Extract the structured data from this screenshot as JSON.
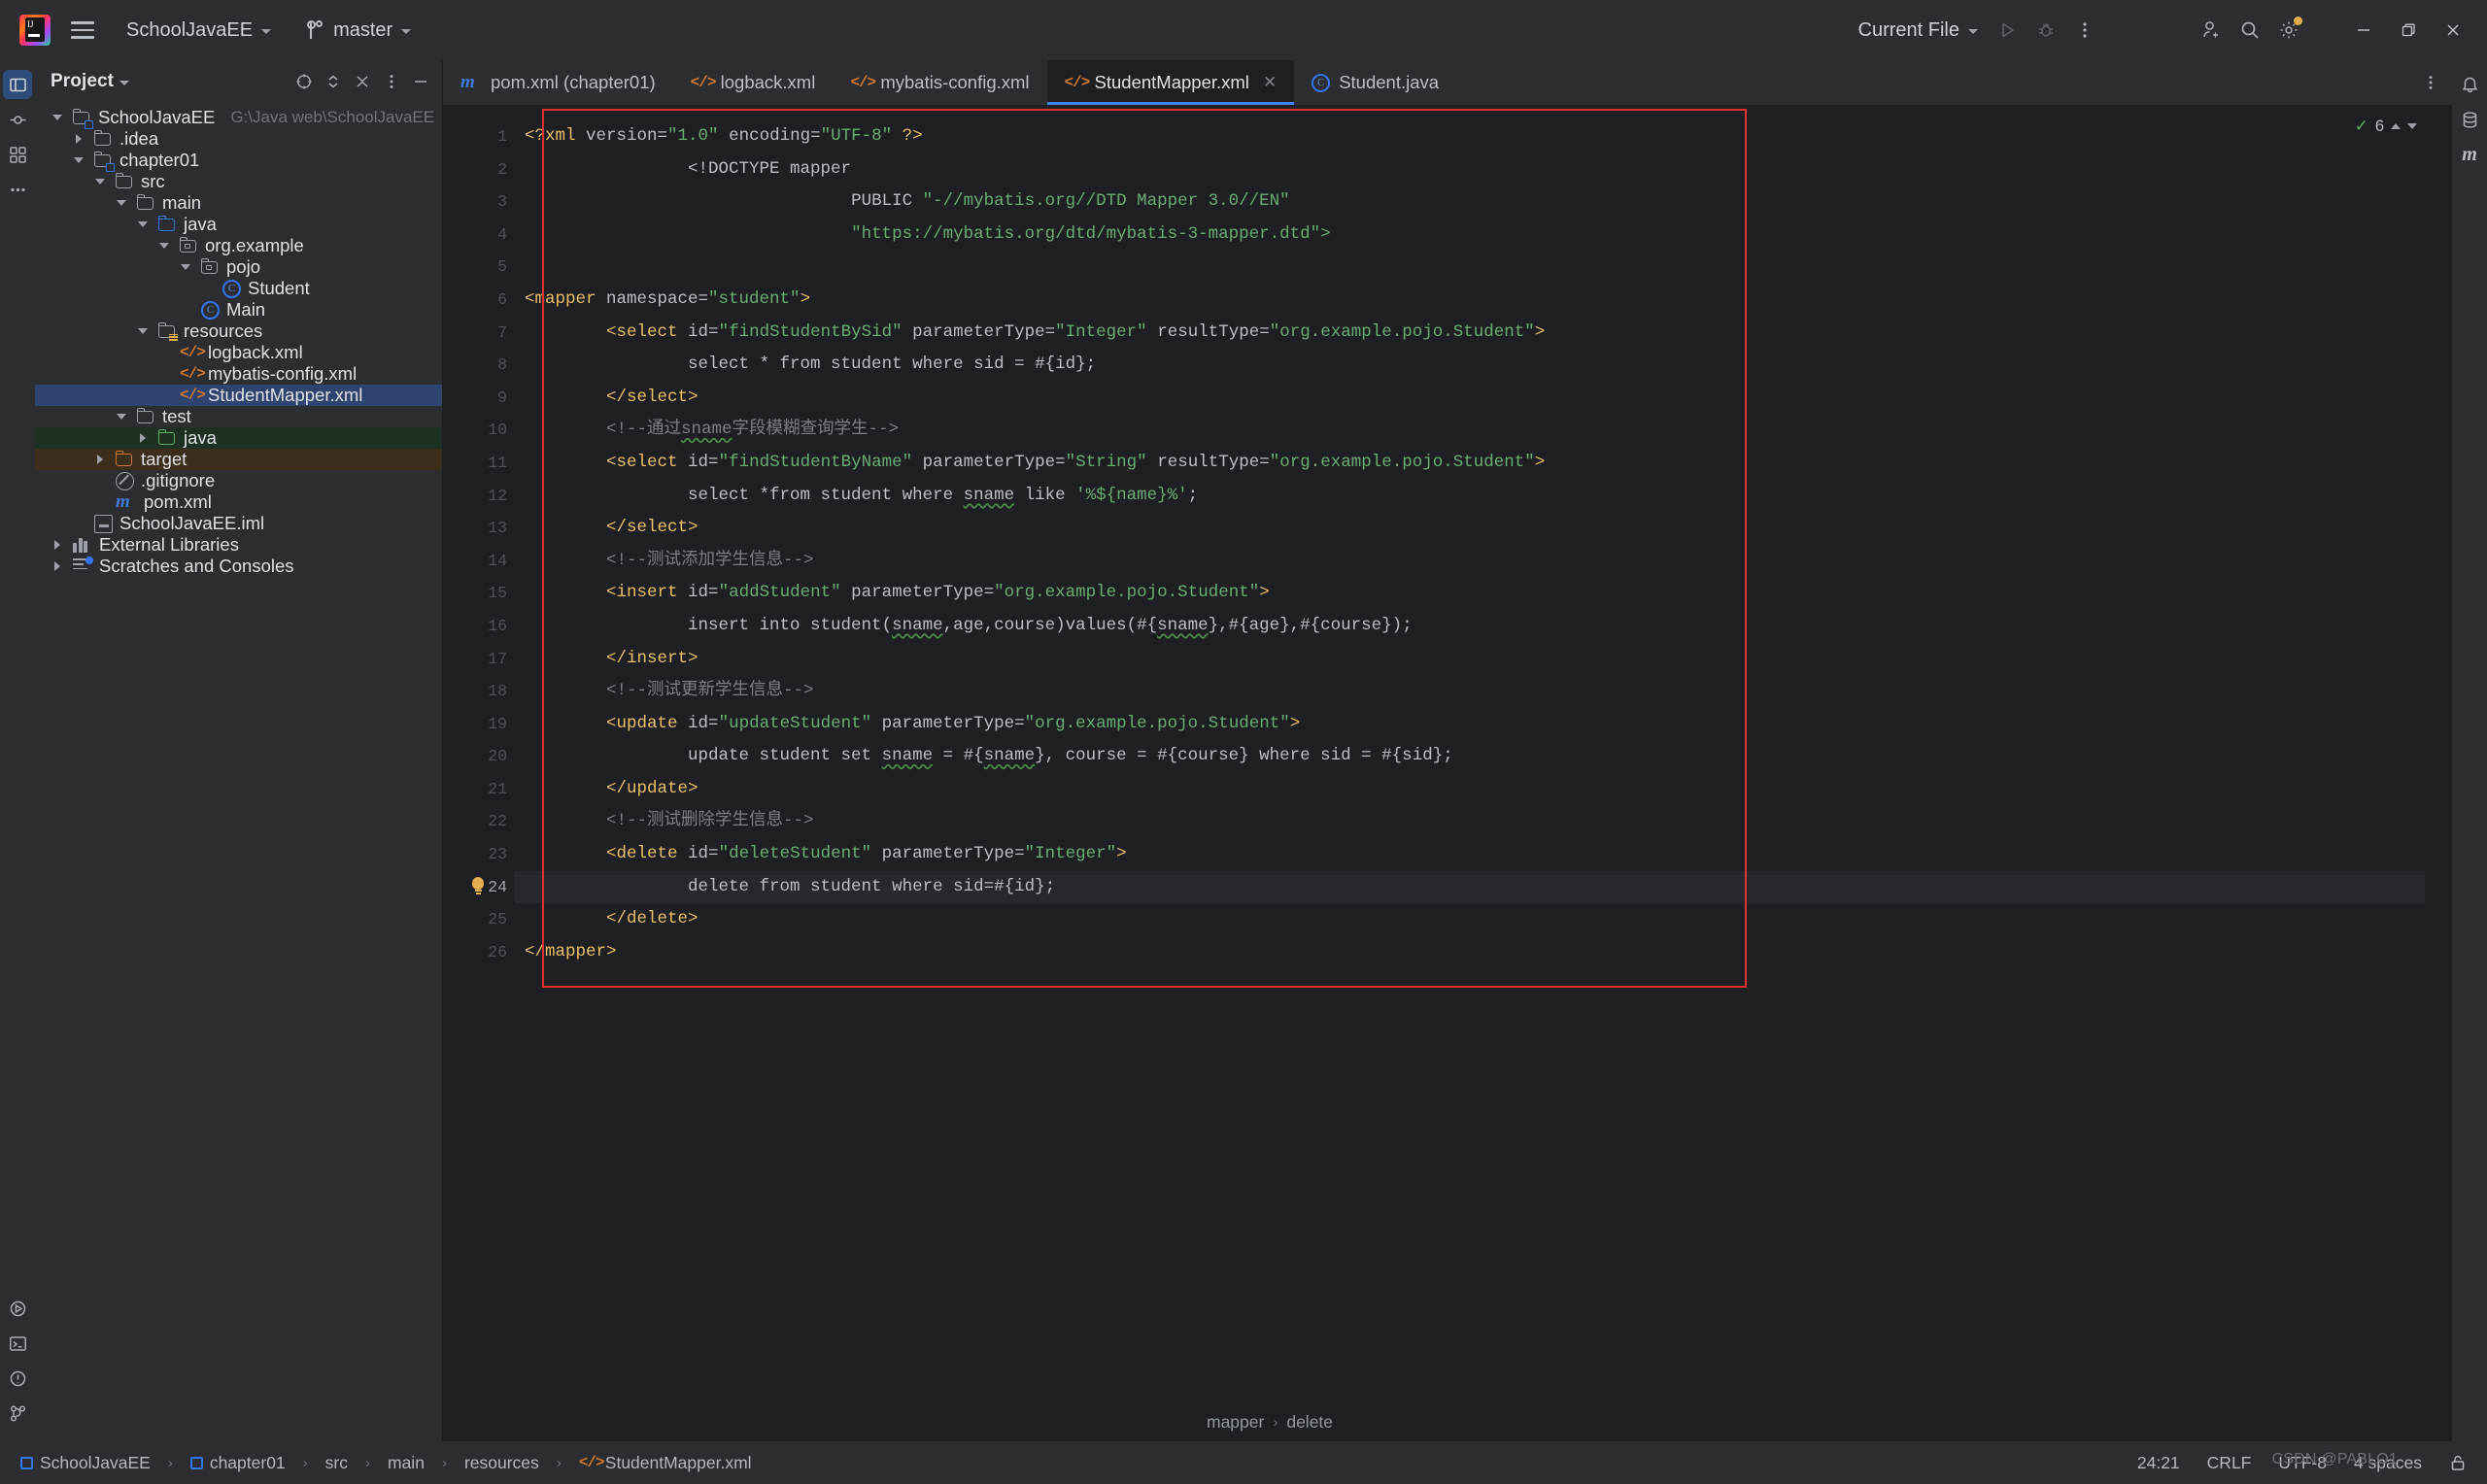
{
  "titlebar": {
    "project_name": "SchoolJavaEE",
    "branch": "master",
    "run_config": "Current File",
    "logo_text": "IJ"
  },
  "project_panel": {
    "title": "Project",
    "tree": [
      {
        "indent": 0,
        "arrow": "down",
        "icon": "module-folder",
        "label": "SchoolJavaEE",
        "path": "G:\\Java web\\SchoolJavaEE",
        "state": "normal"
      },
      {
        "indent": 1,
        "arrow": "right",
        "icon": "folder",
        "label": "",
        "state": "normal",
        "label_text": ".idea"
      },
      {
        "indent": 1,
        "arrow": "down",
        "icon": "module-folder",
        "label": "chapter01",
        "state": "normal"
      },
      {
        "indent": 2,
        "arrow": "down",
        "icon": "folder",
        "label": "src",
        "state": "normal"
      },
      {
        "indent": 3,
        "arrow": "down",
        "icon": "folder",
        "label": "main",
        "state": "normal"
      },
      {
        "indent": 4,
        "arrow": "down",
        "icon": "folder-blue",
        "label": "java",
        "state": "normal"
      },
      {
        "indent": 5,
        "arrow": "down",
        "icon": "package",
        "label": "org.example",
        "state": "normal"
      },
      {
        "indent": 6,
        "arrow": "down",
        "icon": "package",
        "label": "pojo",
        "state": "normal"
      },
      {
        "indent": 7,
        "arrow": "none",
        "icon": "class",
        "label": "Student",
        "state": "normal"
      },
      {
        "indent": 6,
        "arrow": "none",
        "icon": "class",
        "label": "Main",
        "state": "normal"
      },
      {
        "indent": 4,
        "arrow": "down",
        "icon": "folder-resources",
        "label": "resources",
        "state": "normal"
      },
      {
        "indent": 5,
        "arrow": "none",
        "icon": "xml",
        "label": "logback.xml",
        "state": "normal"
      },
      {
        "indent": 5,
        "arrow": "none",
        "icon": "xml",
        "label": "mybatis-config.xml",
        "state": "normal"
      },
      {
        "indent": 5,
        "arrow": "none",
        "icon": "xml",
        "label": "StudentMapper.xml",
        "state": "selected"
      },
      {
        "indent": 3,
        "arrow": "down",
        "icon": "folder",
        "label": "test",
        "state": "normal"
      },
      {
        "indent": 4,
        "arrow": "right",
        "icon": "folder-green",
        "label": "java",
        "state": "test"
      },
      {
        "indent": 2,
        "arrow": "right",
        "icon": "folder-orange",
        "label": "target",
        "state": "target"
      },
      {
        "indent": 2,
        "arrow": "none",
        "icon": "gitignore",
        "label": ".gitignore",
        "state": "normal"
      },
      {
        "indent": 2,
        "arrow": "none",
        "icon": "maven",
        "label": "pom.xml",
        "state": "normal"
      },
      {
        "indent": 1,
        "arrow": "none",
        "icon": "iml",
        "label": "SchoolJavaEE.iml",
        "state": "normal"
      },
      {
        "indent": 0,
        "arrow": "right",
        "icon": "libraries",
        "label": "External Libraries",
        "state": "normal"
      },
      {
        "indent": 0,
        "arrow": "right",
        "icon": "scratches",
        "label": "Scratches and Consoles",
        "state": "normal"
      }
    ]
  },
  "editor": {
    "tabs": [
      {
        "label": "pom.xml (chapter01)",
        "icon": "maven",
        "active": false,
        "closable": false
      },
      {
        "label": "logback.xml",
        "icon": "xml",
        "active": false,
        "closable": false
      },
      {
        "label": "mybatis-config.xml",
        "icon": "xml",
        "active": false,
        "closable": false
      },
      {
        "label": "StudentMapper.xml",
        "icon": "xml",
        "active": true,
        "closable": true
      },
      {
        "label": "Student.java",
        "icon": "class",
        "active": false,
        "closable": false
      }
    ],
    "inspection_count": "6",
    "current_line": 24,
    "total_lines": 26,
    "breadcrumb": [
      "mapper",
      "delete"
    ],
    "lines": [
      {
        "n": 1,
        "segments": [
          {
            "t": "<?xml ",
            "c": "t-tag"
          },
          {
            "t": "version",
            "c": "t-attr"
          },
          {
            "t": "=",
            "c": "t-punct"
          },
          {
            "t": "\"1.0\"",
            "c": "t-str"
          },
          {
            "t": " ",
            "c": "t-text"
          },
          {
            "t": "encoding",
            "c": "t-attr"
          },
          {
            "t": "=",
            "c": "t-punct"
          },
          {
            "t": "\"UTF-8\"",
            "c": "t-str"
          },
          {
            "t": " ?>",
            "c": "t-tag"
          }
        ],
        "indent": 0
      },
      {
        "n": 2,
        "segments": [
          {
            "t": "<!DOCTYPE mapper",
            "c": "t-dt"
          }
        ],
        "indent": 4
      },
      {
        "n": 3,
        "segments": [
          {
            "t": "PUBLIC ",
            "c": "t-attr"
          },
          {
            "t": "\"-//mybatis.org//DTD Mapper 3.0//EN\"",
            "c": "t-str"
          }
        ],
        "indent": 8
      },
      {
        "n": 4,
        "segments": [
          {
            "t": "\"https://mybatis.org/dtd/mybatis-3-mapper.dtd\">",
            "c": "t-str"
          }
        ],
        "indent": 8
      },
      {
        "n": 5,
        "segments": [],
        "indent": 0
      },
      {
        "n": 6,
        "segments": [
          {
            "t": "<mapper ",
            "c": "t-tag"
          },
          {
            "t": "namespace",
            "c": "t-attr"
          },
          {
            "t": "=",
            "c": "t-punct"
          },
          {
            "t": "\"student\"",
            "c": "t-str"
          },
          {
            "t": ">",
            "c": "t-tag"
          }
        ],
        "indent": 0
      },
      {
        "n": 7,
        "segments": [
          {
            "t": "<select ",
            "c": "t-tag"
          },
          {
            "t": "id",
            "c": "t-attr"
          },
          {
            "t": "=",
            "c": "t-punct"
          },
          {
            "t": "\"findStudentBySid\"",
            "c": "t-str"
          },
          {
            "t": " ",
            "c": "t-text"
          },
          {
            "t": "parameterType",
            "c": "t-attr"
          },
          {
            "t": "=",
            "c": "t-punct"
          },
          {
            "t": "\"Integer\"",
            "c": "t-str"
          },
          {
            "t": " ",
            "c": "t-text"
          },
          {
            "t": "resultType",
            "c": "t-attr"
          },
          {
            "t": "=",
            "c": "t-punct"
          },
          {
            "t": "\"org.example.pojo.Student\"",
            "c": "t-str"
          },
          {
            "t": ">",
            "c": "t-tag"
          }
        ],
        "indent": 2
      },
      {
        "n": 8,
        "segments": [
          {
            "t": "select * from student where sid = #{id};",
            "c": "t-text"
          }
        ],
        "indent": 4
      },
      {
        "n": 9,
        "segments": [
          {
            "t": "</select>",
            "c": "t-tag"
          }
        ],
        "indent": 2
      },
      {
        "n": 10,
        "segments": [
          {
            "t": "<!--通过",
            "c": "t-cmt"
          },
          {
            "t": "sname",
            "c": "t-cmt squig"
          },
          {
            "t": "字段模糊查询学生-->",
            "c": "t-cmt"
          }
        ],
        "indent": 2
      },
      {
        "n": 11,
        "segments": [
          {
            "t": "<select ",
            "c": "t-tag"
          },
          {
            "t": "id",
            "c": "t-attr"
          },
          {
            "t": "=",
            "c": "t-punct"
          },
          {
            "t": "\"findStudentByName\"",
            "c": "t-str"
          },
          {
            "t": " ",
            "c": "t-text"
          },
          {
            "t": "parameterType",
            "c": "t-attr"
          },
          {
            "t": "=",
            "c": "t-punct"
          },
          {
            "t": "\"String\"",
            "c": "t-str"
          },
          {
            "t": " ",
            "c": "t-text"
          },
          {
            "t": "resultType",
            "c": "t-attr"
          },
          {
            "t": "=",
            "c": "t-punct"
          },
          {
            "t": "\"org.example.pojo.Student\"",
            "c": "t-str"
          },
          {
            "t": ">",
            "c": "t-tag"
          }
        ],
        "indent": 2
      },
      {
        "n": 12,
        "segments": [
          {
            "t": "select *from student where ",
            "c": "t-text"
          },
          {
            "t": "sname",
            "c": "t-text squig"
          },
          {
            "t": " like ",
            "c": "t-text"
          },
          {
            "t": "'%${name}%'",
            "c": "t-sq"
          },
          {
            "t": ";",
            "c": "t-text"
          }
        ],
        "indent": 4
      },
      {
        "n": 13,
        "segments": [
          {
            "t": "</select>",
            "c": "t-tag"
          }
        ],
        "indent": 2
      },
      {
        "n": 14,
        "segments": [
          {
            "t": "<!--测试添加学生信息-->",
            "c": "t-cmt"
          }
        ],
        "indent": 2
      },
      {
        "n": 15,
        "segments": [
          {
            "t": "<insert ",
            "c": "t-tag"
          },
          {
            "t": "id",
            "c": "t-attr"
          },
          {
            "t": "=",
            "c": "t-punct"
          },
          {
            "t": "\"addStudent\"",
            "c": "t-str"
          },
          {
            "t": " ",
            "c": "t-text"
          },
          {
            "t": "parameterType",
            "c": "t-attr"
          },
          {
            "t": "=",
            "c": "t-punct"
          },
          {
            "t": "\"org.example.pojo.Student\"",
            "c": "t-str"
          },
          {
            "t": ">",
            "c": "t-tag"
          }
        ],
        "indent": 2
      },
      {
        "n": 16,
        "segments": [
          {
            "t": "insert into student(",
            "c": "t-text"
          },
          {
            "t": "sname",
            "c": "t-text squig"
          },
          {
            "t": ",age,course)values(#{",
            "c": "t-text"
          },
          {
            "t": "sname",
            "c": "t-text squig"
          },
          {
            "t": "},#{age},#{course});",
            "c": "t-text"
          }
        ],
        "indent": 4
      },
      {
        "n": 17,
        "segments": [
          {
            "t": "</insert>",
            "c": "t-tag"
          }
        ],
        "indent": 2
      },
      {
        "n": 18,
        "segments": [
          {
            "t": "<!--测试更新学生信息-->",
            "c": "t-cmt"
          }
        ],
        "indent": 2
      },
      {
        "n": 19,
        "segments": [
          {
            "t": "<update ",
            "c": "t-tag"
          },
          {
            "t": "id",
            "c": "t-attr"
          },
          {
            "t": "=",
            "c": "t-punct"
          },
          {
            "t": "\"updateStudent\"",
            "c": "t-str"
          },
          {
            "t": " ",
            "c": "t-text"
          },
          {
            "t": "parameterType",
            "c": "t-attr"
          },
          {
            "t": "=",
            "c": "t-punct"
          },
          {
            "t": "\"org.example.pojo.Student\"",
            "c": "t-str"
          },
          {
            "t": ">",
            "c": "t-tag"
          }
        ],
        "indent": 2
      },
      {
        "n": 20,
        "segments": [
          {
            "t": "update student set ",
            "c": "t-text"
          },
          {
            "t": "sname",
            "c": "t-text squig"
          },
          {
            "t": " = #{",
            "c": "t-text"
          },
          {
            "t": "sname",
            "c": "t-text squig"
          },
          {
            "t": "}, course = #{course} where sid = #{sid};",
            "c": "t-text"
          }
        ],
        "indent": 4
      },
      {
        "n": 21,
        "segments": [
          {
            "t": "</update>",
            "c": "t-tag"
          }
        ],
        "indent": 2
      },
      {
        "n": 22,
        "segments": [
          {
            "t": "<!--测试删除学生信息-->",
            "c": "t-cmt"
          }
        ],
        "indent": 2
      },
      {
        "n": 23,
        "segments": [
          {
            "t": "<delete ",
            "c": "t-tag"
          },
          {
            "t": "id",
            "c": "t-attr"
          },
          {
            "t": "=",
            "c": "t-punct"
          },
          {
            "t": "\"deleteStudent\"",
            "c": "t-str"
          },
          {
            "t": " ",
            "c": "t-text"
          },
          {
            "t": "parameterType",
            "c": "t-attr"
          },
          {
            "t": "=",
            "c": "t-punct"
          },
          {
            "t": "\"Integer\"",
            "c": "t-str"
          },
          {
            "t": ">",
            "c": "t-tag"
          }
        ],
        "indent": 2
      },
      {
        "n": 24,
        "segments": [
          {
            "t": "delete from student where sid=#{id};",
            "c": "t-text"
          }
        ],
        "indent": 4,
        "current": true,
        "bulb": true
      },
      {
        "n": 25,
        "segments": [
          {
            "t": "</delete>",
            "c": "t-tag"
          }
        ],
        "indent": 2
      },
      {
        "n": 26,
        "segments": [
          {
            "t": "</mapper>",
            "c": "t-tag"
          }
        ],
        "indent": 0
      }
    ]
  },
  "statusbar": {
    "breadcrumb": [
      "SchoolJavaEE",
      "chapter01",
      "src",
      "main",
      "resources",
      "StudentMapper.xml"
    ],
    "caret_position": "24:21",
    "line_separator": "CRLF",
    "encoding": "UTF-8",
    "indent": "4 spaces",
    "watermark": "CSDN @PABLO1"
  },
  "colors": {
    "accent": "#3574f0",
    "selection": "#2e436e",
    "tab_underline": "#4682fa",
    "error_box": "#e03030",
    "xml_icon": "#cc7832",
    "string": "#6aab73",
    "tag": "#e8bf6a",
    "comment": "#7a7e85"
  }
}
